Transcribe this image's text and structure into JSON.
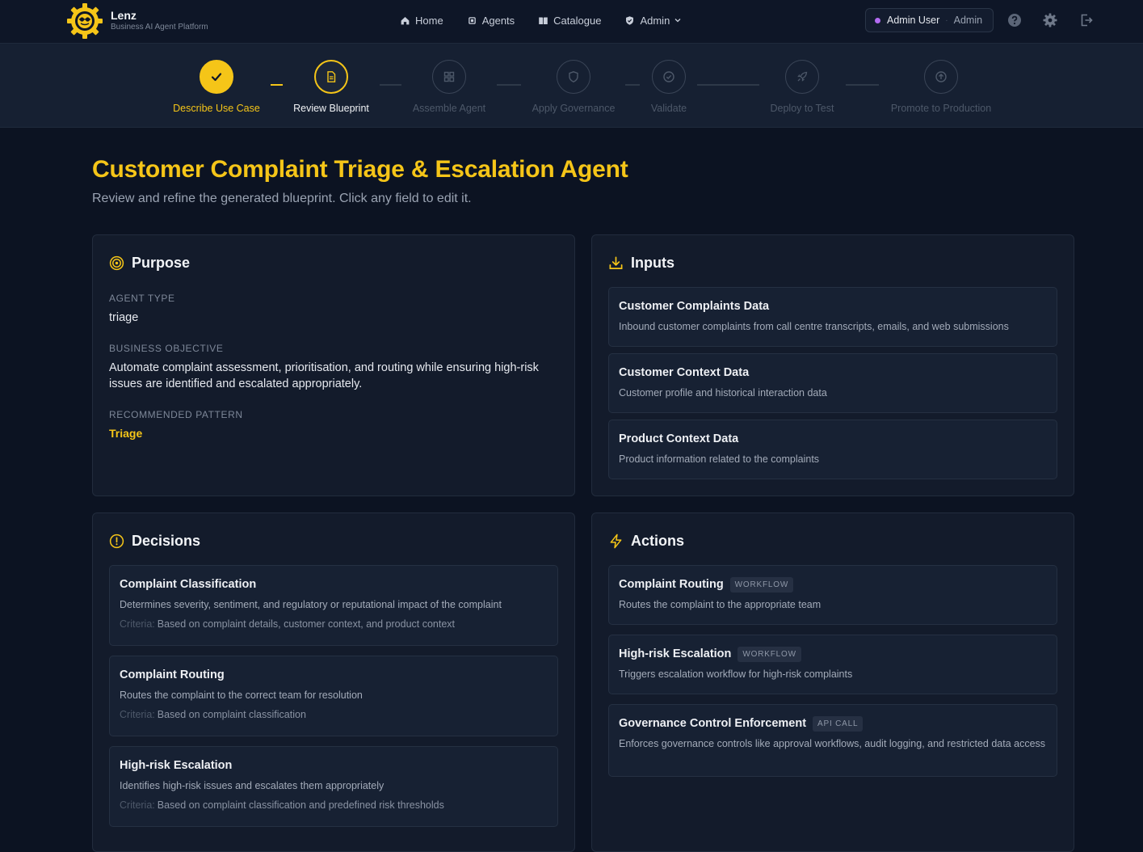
{
  "brand": {
    "name": "Lenz",
    "tagline": "Business AI Agent Platform"
  },
  "nav": {
    "home": "Home",
    "agents": "Agents",
    "catalogue": "Catalogue",
    "admin": "Admin"
  },
  "user": {
    "name": "Admin User",
    "separator": "·",
    "role": "Admin"
  },
  "stepper": {
    "steps": [
      {
        "label": "Describe Use Case",
        "state": "done"
      },
      {
        "label": "Review Blueprint",
        "state": "active"
      },
      {
        "label": "Assemble Agent",
        "state": "pending"
      },
      {
        "label": "Apply Governance",
        "state": "pending"
      },
      {
        "label": "Validate",
        "state": "pending"
      },
      {
        "label": "Deploy to Test",
        "state": "pending"
      },
      {
        "label": "Promote to Production",
        "state": "pending"
      }
    ]
  },
  "page": {
    "title": "Customer Complaint Triage & Escalation Agent",
    "subtitle": "Review and refine the generated blueprint. Click any field to edit it."
  },
  "purpose": {
    "title": "Purpose",
    "agent_type_label": "AGENT TYPE",
    "agent_type": "triage",
    "objective_label": "BUSINESS OBJECTIVE",
    "objective": "Automate complaint assessment, prioritisation, and routing while ensuring high-risk issues are identified and escalated appropriately.",
    "pattern_label": "RECOMMENDED PATTERN",
    "pattern": "Triage"
  },
  "inputs": {
    "title": "Inputs",
    "items": [
      {
        "title": "Customer Complaints Data",
        "desc": "Inbound customer complaints from call centre transcripts, emails, and web submissions"
      },
      {
        "title": "Customer Context Data",
        "desc": "Customer profile and historical interaction data"
      },
      {
        "title": "Product Context Data",
        "desc": "Product information related to the complaints"
      }
    ]
  },
  "decisions": {
    "title": "Decisions",
    "criteria_label": "Criteria:",
    "items": [
      {
        "title": "Complaint Classification",
        "desc": "Determines severity, sentiment, and regulatory or reputational impact of the complaint",
        "criteria": "Based on complaint details, customer context, and product context"
      },
      {
        "title": "Complaint Routing",
        "desc": "Routes the complaint to the correct team for resolution",
        "criteria": "Based on complaint classification"
      },
      {
        "title": "High-risk Escalation",
        "desc": "Identifies high-risk issues and escalates them appropriately",
        "criteria": "Based on complaint classification and predefined risk thresholds"
      }
    ]
  },
  "actions": {
    "title": "Actions",
    "items": [
      {
        "title": "Complaint Routing",
        "badge": "WORKFLOW",
        "desc": "Routes the complaint to the appropriate team"
      },
      {
        "title": "High-risk Escalation",
        "badge": "WORKFLOW",
        "desc": "Triggers escalation workflow for high-risk complaints"
      },
      {
        "title": "Governance Control Enforcement",
        "badge": "API CALL",
        "desc": "Enforces governance controls like approval workflows, audit logging, and restricted data access"
      }
    ]
  },
  "colors": {
    "accent": "#f5c518",
    "background": "#0c1322",
    "card": "#131b2b",
    "user_dot": "#b36bf2"
  }
}
